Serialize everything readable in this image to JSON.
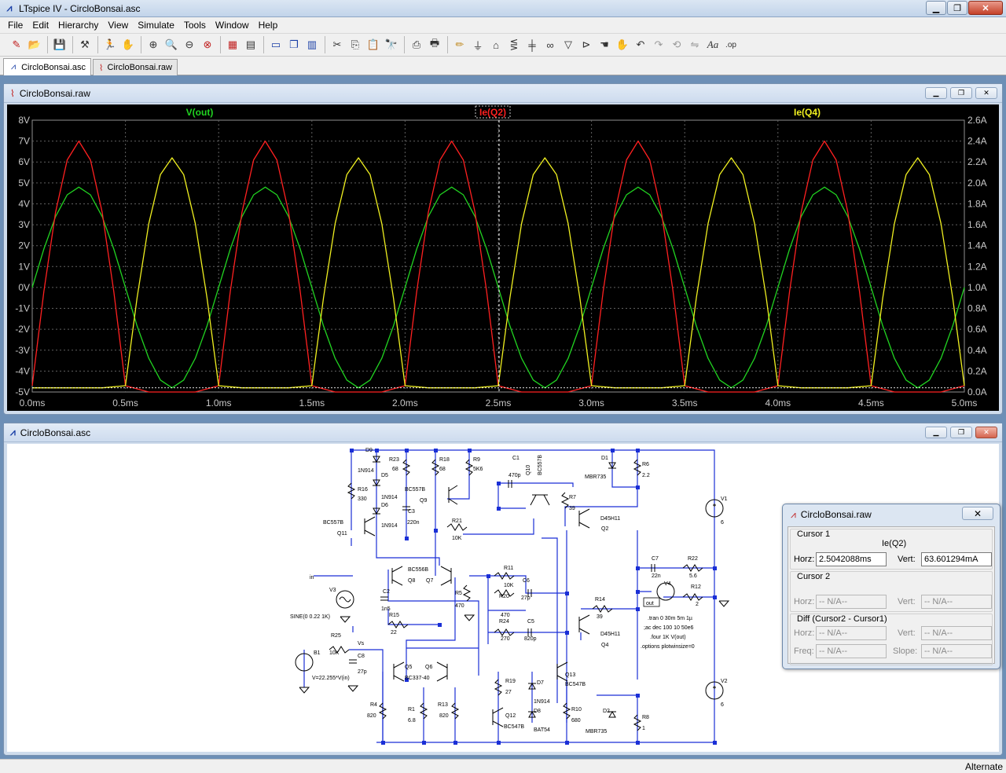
{
  "app": {
    "title": "LTspice IV - CircloBonsai.asc"
  },
  "menu": [
    "File",
    "Edit",
    "Hierarchy",
    "View",
    "Simulate",
    "Tools",
    "Window",
    "Help"
  ],
  "toolbar": {
    "buttons": [
      "new-schematic",
      "open",
      "save",
      "control-panel",
      "run",
      "pan",
      "zoom-in",
      "zoom-rect",
      "zoom-out",
      "zoom-fit",
      "autorange",
      "grid",
      "tile-horizontal",
      "cascade",
      "tile-vertical",
      "cut",
      "copy",
      "paste",
      "find",
      "print-setup",
      "print",
      "draw-wire",
      "ground",
      "label-net",
      "resistor",
      "capacitor",
      "inductor",
      "diode",
      "component",
      "move",
      "drag",
      "undo",
      "redo",
      "rotate",
      "mirror",
      "text",
      "spice-directive"
    ]
  },
  "tabs": [
    {
      "label": "CircloBonsai.asc",
      "icon": "schematic-icon"
    },
    {
      "label": "CircloBonsai.raw",
      "icon": "waveform-icon"
    }
  ],
  "waveform_window": {
    "title": "CircloBonsai.raw"
  },
  "schematic_window": {
    "title": "CircloBonsai.asc"
  },
  "schematic_labels": {
    "D9": "D9",
    "D9v": "1N914",
    "D5": "D5",
    "D5v": "1N914",
    "D6": "D6",
    "D6v": "1N914",
    "R23": "R23",
    "R23v": "68",
    "R18": "R18",
    "R18v": "68",
    "R9": "R9",
    "R9v": "5K6",
    "C1": "C1",
    "C1v": "470p",
    "Q10": "Q10",
    "Q10v": "BC557B",
    "D1": "D1",
    "D1v": "MBR735",
    "R6": "R6",
    "R6v": "2.2",
    "R16": "R16",
    "R16v": "330",
    "Q9": "Q9",
    "Q9v": "BC557B",
    "C3": "C3",
    "C3v": "220n",
    "R7": "R7",
    "R7v": "39",
    "Q2": "Q2",
    "Q2v": "D45H11",
    "Q11": "Q11",
    "Q11v": "BC557B",
    "R21": "R21",
    "R21v": "10K",
    "V1": "V1",
    "V1v": "6",
    "in": "in",
    "Q8": "Q8",
    "Q7": "Q7",
    "Q78v": "BC556B",
    "R11": "R11",
    "R11v": "10K",
    "C6": "C6",
    "C6v": "27p",
    "C7": "C7",
    "C7v": "22n",
    "R22": "R22",
    "R22v": "5.6",
    "V3": "V3",
    "V3v": "SINE(0 0.22 1K)",
    "C2": "C2",
    "C2v": "1n5",
    "R5": "R5",
    "R5v": "470",
    "R20": "R20",
    "R20v": "470",
    "V4": "V4",
    "R12": "R12",
    "R12v": "2",
    "out": "out",
    "R15": "R15",
    "R15v": "22",
    "R14": "R14",
    "R14v": "39",
    "R24": "R24",
    "R24v": "270",
    "C5": "C5",
    "C5v": "820p",
    "Q4": "Q4",
    "Q4v": "D45H11",
    "d1": ".tran 0 30m 5m 1µ",
    "d2": ";ac dec 100 10 50e6",
    "d3": ".four 1K V(out)",
    "d4": ".options plotwinsize=0",
    "R25": "R25",
    "R25v": "10K",
    "Vs": "Vs",
    "C8": "C8",
    "C8v": "27p",
    "B1": "B1",
    "B1v": "V=22.255*V(in)",
    "Q5": "Q5",
    "Q6": "Q6",
    "Q56v": "BC337-40",
    "Q13": "Q13",
    "Q13v": "BC547B",
    "R19": "R19",
    "R19v": "27",
    "D7": "D7",
    "D7v": "1N914",
    "R4": "R4",
    "R4v": "820",
    "R1": "R1",
    "R1v": "6.8",
    "R13": "R13",
    "R13v": "820",
    "R10": "R10",
    "R10v": "680",
    "D8": "D8",
    "D8v": "BAT54",
    "Q12": "Q12",
    "Q12v": "BC547B",
    "D2": "D2",
    "D2v": "MBR735",
    "R8": "R8",
    "R8v": "1",
    "V2": "V2",
    "V2v": "6"
  },
  "cursor_window": {
    "title": "CircloBonsai.raw",
    "cursor1_label": "Cursor 1",
    "trace_name": "Ie(Q2)",
    "horz_label": "Horz:",
    "horz_value": "2.5042088ms",
    "vert_label": "Vert:",
    "vert_value": "63.601294mA",
    "cursor2_label": "Cursor 2",
    "horz2_label": "Horz:",
    "horz2_value": "-- N/A--",
    "vert2_label": "Vert:",
    "vert2_value": "-- N/A--",
    "diff_label": "Diff (Cursor2 - Cursor1)",
    "horz3_label": "Horz:",
    "horz3_value": "-- N/A--",
    "vert3_label": "Vert:",
    "vert3_value": "-- N/A--",
    "freq_label": "Freq:",
    "freq_value": "-- N/A--",
    "slope_label": "Slope:",
    "slope_value": "-- N/A--"
  },
  "status": {
    "text": "Alternate"
  },
  "colors": {
    "vout": "#21d321",
    "ieq2": "#ff2020",
    "ieq4": "#f0f020",
    "grid": "#606060",
    "wire": "#1a2fd6",
    "part": "#000000"
  },
  "chart_data": {
    "type": "line",
    "x_unit": "ms",
    "xlim": [
      0.0,
      5.0
    ],
    "xticks": [
      "0.0ms",
      "0.5ms",
      "1.0ms",
      "1.5ms",
      "2.0ms",
      "2.5ms",
      "3.0ms",
      "3.5ms",
      "4.0ms",
      "4.5ms",
      "5.0ms"
    ],
    "left_axis": {
      "ylim": [
        -5,
        8
      ],
      "ticks": [
        "8V",
        "7V",
        "6V",
        "5V",
        "4V",
        "3V",
        "2V",
        "1V",
        "0V",
        "-1V",
        "-2V",
        "-3V",
        "-4V",
        "-5V"
      ]
    },
    "right_axis": {
      "ylim": [
        0.0,
        2.6
      ],
      "ticks": [
        "2.6A",
        "2.4A",
        "2.2A",
        "2.0A",
        "1.8A",
        "1.6A",
        "1.4A",
        "1.2A",
        "1.0A",
        "0.8A",
        "0.6A",
        "0.4A",
        "0.2A",
        "0.0A"
      ]
    },
    "grid": true,
    "cursor_x": 2.5042088,
    "series": [
      {
        "name": "V(out)",
        "axis": "left",
        "color": "#21d321",
        "x": [
          0,
          0.0625,
          0.125,
          0.1875,
          0.25,
          0.3125,
          0.375,
          0.4375,
          0.5,
          0.5625,
          0.625,
          0.6875,
          0.75,
          0.8125,
          0.875,
          0.9375,
          1.0,
          1.0625,
          1.125,
          1.1875,
          1.25,
          1.3125,
          1.375,
          1.4375,
          1.5,
          1.5625,
          1.625,
          1.6875,
          1.75,
          1.8125,
          1.875,
          1.9375,
          2.0,
          2.0625,
          2.125,
          2.1875,
          2.25,
          2.3125,
          2.375,
          2.4375,
          2.5,
          2.5625,
          2.625,
          2.6875,
          2.75,
          2.8125,
          2.875,
          2.9375,
          3.0,
          3.0625,
          3.125,
          3.1875,
          3.25,
          3.3125,
          3.375,
          3.4375,
          3.5,
          3.5625,
          3.625,
          3.6875,
          3.75,
          3.8125,
          3.875,
          3.9375,
          4.0,
          4.0625,
          4.125,
          4.1875,
          4.25,
          4.3125,
          4.375,
          4.4375,
          4.5,
          4.5625,
          4.625,
          4.6875,
          4.75,
          4.8125,
          4.875,
          4.9375,
          5.0
        ],
        "y": [
          0.0,
          1.84,
          3.39,
          4.43,
          4.8,
          4.43,
          3.39,
          1.84,
          0.0,
          -1.84,
          -3.39,
          -4.43,
          -4.8,
          -4.43,
          -3.39,
          -1.84,
          0.0,
          1.84,
          3.39,
          4.43,
          4.8,
          4.43,
          3.39,
          1.84,
          0.0,
          -1.84,
          -3.39,
          -4.43,
          -4.8,
          -4.43,
          -3.39,
          -1.84,
          0.0,
          1.84,
          3.39,
          4.43,
          4.8,
          4.43,
          3.39,
          1.84,
          0.0,
          -1.84,
          -3.39,
          -4.43,
          -4.8,
          -4.43,
          -3.39,
          -1.84,
          0.0,
          1.84,
          3.39,
          4.43,
          4.8,
          4.43,
          3.39,
          1.84,
          0.0,
          -1.84,
          -3.39,
          -4.43,
          -4.8,
          -4.43,
          -3.39,
          -1.84,
          0.0,
          1.84,
          3.39,
          4.43,
          4.8,
          4.43,
          3.39,
          1.84,
          0.0,
          -1.84,
          -3.39,
          -4.43,
          -4.8,
          -4.43,
          -3.39,
          -1.84,
          0.0
        ]
      },
      {
        "name": "Ie(Q2)",
        "axis": "right",
        "color": "#ff2020",
        "x": [
          0,
          0.0625,
          0.125,
          0.1875,
          0.25,
          0.3125,
          0.375,
          0.4375,
          0.5,
          0.625,
          0.75,
          0.875,
          1.0,
          1.0625,
          1.125,
          1.1875,
          1.25,
          1.3125,
          1.375,
          1.4375,
          1.5,
          1.625,
          1.75,
          1.875,
          2.0,
          2.0625,
          2.125,
          2.1875,
          2.25,
          2.3125,
          2.375,
          2.4375,
          2.5,
          2.625,
          2.75,
          2.875,
          3.0,
          3.0625,
          3.125,
          3.1875,
          3.25,
          3.3125,
          3.375,
          3.4375,
          3.5,
          3.625,
          3.75,
          3.875,
          4.0,
          4.0625,
          4.125,
          4.1875,
          4.25,
          4.3125,
          4.375,
          4.4375,
          4.5,
          4.625,
          4.75,
          4.875,
          5.0
        ],
        "y": [
          0.06,
          0.96,
          1.72,
          2.22,
          2.4,
          2.22,
          1.72,
          0.96,
          0.06,
          0.0,
          0.0,
          0.0,
          0.06,
          0.96,
          1.72,
          2.22,
          2.4,
          2.22,
          1.72,
          0.96,
          0.06,
          0.0,
          0.0,
          0.0,
          0.06,
          0.96,
          1.72,
          2.22,
          2.4,
          2.22,
          1.72,
          0.96,
          0.06,
          0.0,
          0.0,
          0.0,
          0.06,
          0.96,
          1.72,
          2.22,
          2.4,
          2.22,
          1.72,
          0.96,
          0.06,
          0.0,
          0.0,
          0.0,
          0.06,
          0.96,
          1.72,
          2.22,
          2.4,
          2.22,
          1.72,
          0.96,
          0.06,
          0.0,
          0.0,
          0.0,
          0.06
        ]
      },
      {
        "name": "Ie(Q4)",
        "axis": "right",
        "color": "#f0f020",
        "x": [
          0,
          0.125,
          0.25,
          0.375,
          0.5,
          0.5625,
          0.625,
          0.6875,
          0.75,
          0.8125,
          0.875,
          0.9375,
          1.0,
          1.125,
          1.25,
          1.375,
          1.5,
          1.5625,
          1.625,
          1.6875,
          1.75,
          1.8125,
          1.875,
          1.9375,
          2.0,
          2.125,
          2.25,
          2.375,
          2.5,
          2.5625,
          2.625,
          2.6875,
          2.75,
          2.8125,
          2.875,
          2.9375,
          3.0,
          3.125,
          3.25,
          3.375,
          3.5,
          3.5625,
          3.625,
          3.6875,
          3.75,
          3.8125,
          3.875,
          3.9375,
          4.0,
          4.125,
          4.25,
          4.375,
          4.5,
          4.5625,
          4.625,
          4.6875,
          4.75,
          4.8125,
          4.875,
          4.9375,
          5.0
        ],
        "y": [
          0.04,
          0.04,
          0.04,
          0.04,
          0.06,
          0.9,
          1.61,
          2.08,
          2.24,
          2.08,
          1.61,
          0.9,
          0.06,
          0.04,
          0.04,
          0.04,
          0.06,
          0.9,
          1.61,
          2.08,
          2.24,
          2.08,
          1.61,
          0.9,
          0.06,
          0.04,
          0.04,
          0.04,
          0.06,
          0.9,
          1.61,
          2.08,
          2.24,
          2.08,
          1.61,
          0.9,
          0.06,
          0.04,
          0.04,
          0.04,
          0.06,
          0.9,
          1.61,
          2.08,
          2.24,
          2.08,
          1.61,
          0.9,
          0.06,
          0.04,
          0.04,
          0.04,
          0.06,
          0.9,
          1.61,
          2.08,
          2.24,
          2.08,
          1.61,
          0.9,
          0.06
        ]
      }
    ]
  }
}
